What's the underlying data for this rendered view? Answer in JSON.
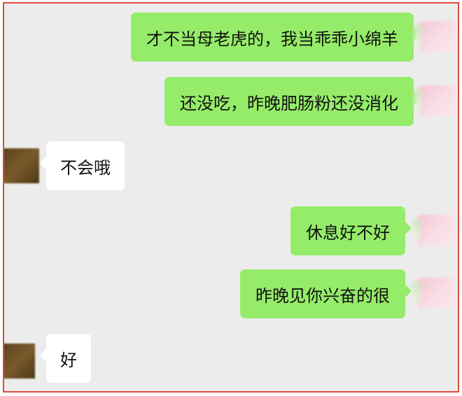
{
  "chat": {
    "messages": [
      {
        "side": "out",
        "text": "才不当母老虎的，我当乖乖小绵羊",
        "avatar_icon": "blurred-avatar-icon"
      },
      {
        "side": "out",
        "text": "还没吃，昨晚肥肠粉还没消化",
        "avatar_icon": "blurred-avatar-icon"
      },
      {
        "side": "in",
        "text": "不会哦",
        "avatar_icon": "blurred-avatar-icon"
      },
      {
        "side": "out",
        "text": "休息好不好",
        "avatar_icon": "blurred-avatar-icon"
      },
      {
        "side": "out",
        "text": "昨晚见你兴奋的很",
        "avatar_icon": "blurred-avatar-icon"
      },
      {
        "side": "in",
        "text": "好",
        "avatar_icon": "blurred-avatar-icon"
      }
    ]
  },
  "colors": {
    "frame_border": "#e34a3e",
    "background": "#ececec",
    "outgoing_bubble": "#95ec69",
    "incoming_bubble": "#ffffff"
  }
}
